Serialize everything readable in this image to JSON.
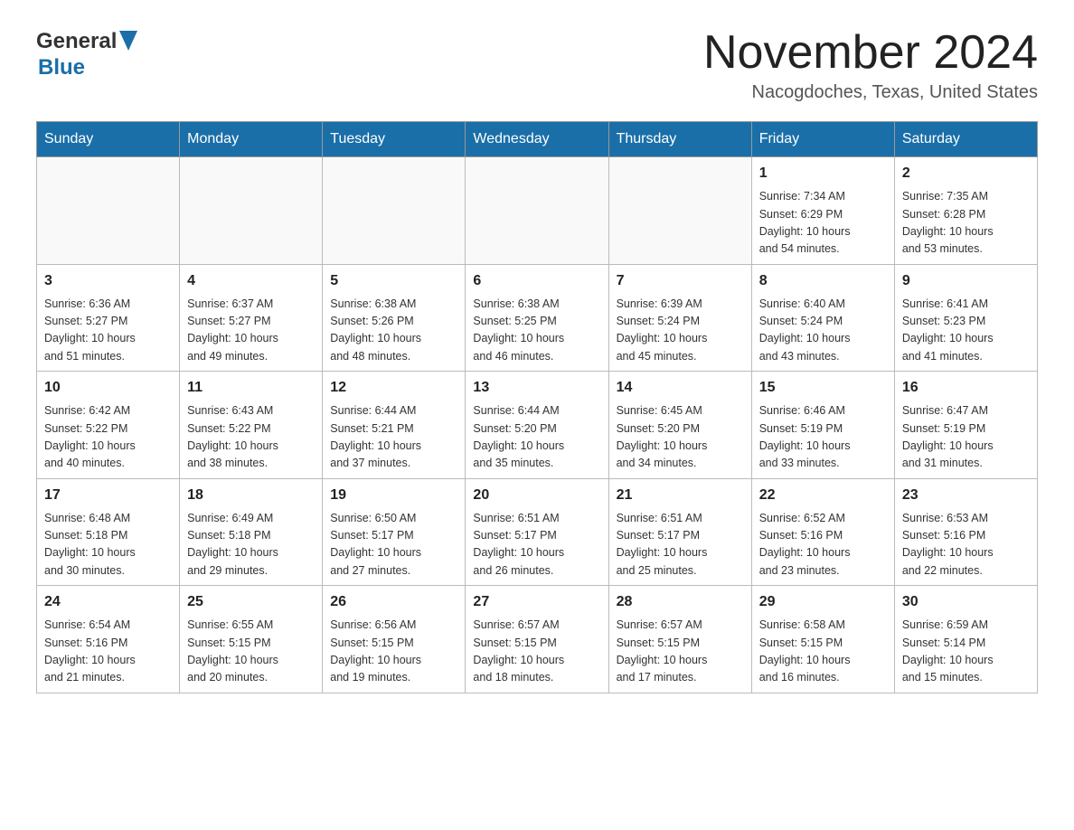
{
  "header": {
    "logo_general": "General",
    "logo_blue": "Blue",
    "month_title": "November 2024",
    "location": "Nacogdoches, Texas, United States"
  },
  "weekdays": [
    "Sunday",
    "Monday",
    "Tuesday",
    "Wednesday",
    "Thursday",
    "Friday",
    "Saturday"
  ],
  "weeks": [
    [
      {
        "day": "",
        "info": ""
      },
      {
        "day": "",
        "info": ""
      },
      {
        "day": "",
        "info": ""
      },
      {
        "day": "",
        "info": ""
      },
      {
        "day": "",
        "info": ""
      },
      {
        "day": "1",
        "info": "Sunrise: 7:34 AM\nSunset: 6:29 PM\nDaylight: 10 hours\nand 54 minutes."
      },
      {
        "day": "2",
        "info": "Sunrise: 7:35 AM\nSunset: 6:28 PM\nDaylight: 10 hours\nand 53 minutes."
      }
    ],
    [
      {
        "day": "3",
        "info": "Sunrise: 6:36 AM\nSunset: 5:27 PM\nDaylight: 10 hours\nand 51 minutes."
      },
      {
        "day": "4",
        "info": "Sunrise: 6:37 AM\nSunset: 5:27 PM\nDaylight: 10 hours\nand 49 minutes."
      },
      {
        "day": "5",
        "info": "Sunrise: 6:38 AM\nSunset: 5:26 PM\nDaylight: 10 hours\nand 48 minutes."
      },
      {
        "day": "6",
        "info": "Sunrise: 6:38 AM\nSunset: 5:25 PM\nDaylight: 10 hours\nand 46 minutes."
      },
      {
        "day": "7",
        "info": "Sunrise: 6:39 AM\nSunset: 5:24 PM\nDaylight: 10 hours\nand 45 minutes."
      },
      {
        "day": "8",
        "info": "Sunrise: 6:40 AM\nSunset: 5:24 PM\nDaylight: 10 hours\nand 43 minutes."
      },
      {
        "day": "9",
        "info": "Sunrise: 6:41 AM\nSunset: 5:23 PM\nDaylight: 10 hours\nand 41 minutes."
      }
    ],
    [
      {
        "day": "10",
        "info": "Sunrise: 6:42 AM\nSunset: 5:22 PM\nDaylight: 10 hours\nand 40 minutes."
      },
      {
        "day": "11",
        "info": "Sunrise: 6:43 AM\nSunset: 5:22 PM\nDaylight: 10 hours\nand 38 minutes."
      },
      {
        "day": "12",
        "info": "Sunrise: 6:44 AM\nSunset: 5:21 PM\nDaylight: 10 hours\nand 37 minutes."
      },
      {
        "day": "13",
        "info": "Sunrise: 6:44 AM\nSunset: 5:20 PM\nDaylight: 10 hours\nand 35 minutes."
      },
      {
        "day": "14",
        "info": "Sunrise: 6:45 AM\nSunset: 5:20 PM\nDaylight: 10 hours\nand 34 minutes."
      },
      {
        "day": "15",
        "info": "Sunrise: 6:46 AM\nSunset: 5:19 PM\nDaylight: 10 hours\nand 33 minutes."
      },
      {
        "day": "16",
        "info": "Sunrise: 6:47 AM\nSunset: 5:19 PM\nDaylight: 10 hours\nand 31 minutes."
      }
    ],
    [
      {
        "day": "17",
        "info": "Sunrise: 6:48 AM\nSunset: 5:18 PM\nDaylight: 10 hours\nand 30 minutes."
      },
      {
        "day": "18",
        "info": "Sunrise: 6:49 AM\nSunset: 5:18 PM\nDaylight: 10 hours\nand 29 minutes."
      },
      {
        "day": "19",
        "info": "Sunrise: 6:50 AM\nSunset: 5:17 PM\nDaylight: 10 hours\nand 27 minutes."
      },
      {
        "day": "20",
        "info": "Sunrise: 6:51 AM\nSunset: 5:17 PM\nDaylight: 10 hours\nand 26 minutes."
      },
      {
        "day": "21",
        "info": "Sunrise: 6:51 AM\nSunset: 5:17 PM\nDaylight: 10 hours\nand 25 minutes."
      },
      {
        "day": "22",
        "info": "Sunrise: 6:52 AM\nSunset: 5:16 PM\nDaylight: 10 hours\nand 23 minutes."
      },
      {
        "day": "23",
        "info": "Sunrise: 6:53 AM\nSunset: 5:16 PM\nDaylight: 10 hours\nand 22 minutes."
      }
    ],
    [
      {
        "day": "24",
        "info": "Sunrise: 6:54 AM\nSunset: 5:16 PM\nDaylight: 10 hours\nand 21 minutes."
      },
      {
        "day": "25",
        "info": "Sunrise: 6:55 AM\nSunset: 5:15 PM\nDaylight: 10 hours\nand 20 minutes."
      },
      {
        "day": "26",
        "info": "Sunrise: 6:56 AM\nSunset: 5:15 PM\nDaylight: 10 hours\nand 19 minutes."
      },
      {
        "day": "27",
        "info": "Sunrise: 6:57 AM\nSunset: 5:15 PM\nDaylight: 10 hours\nand 18 minutes."
      },
      {
        "day": "28",
        "info": "Sunrise: 6:57 AM\nSunset: 5:15 PM\nDaylight: 10 hours\nand 17 minutes."
      },
      {
        "day": "29",
        "info": "Sunrise: 6:58 AM\nSunset: 5:15 PM\nDaylight: 10 hours\nand 16 minutes."
      },
      {
        "day": "30",
        "info": "Sunrise: 6:59 AM\nSunset: 5:14 PM\nDaylight: 10 hours\nand 15 minutes."
      }
    ]
  ]
}
